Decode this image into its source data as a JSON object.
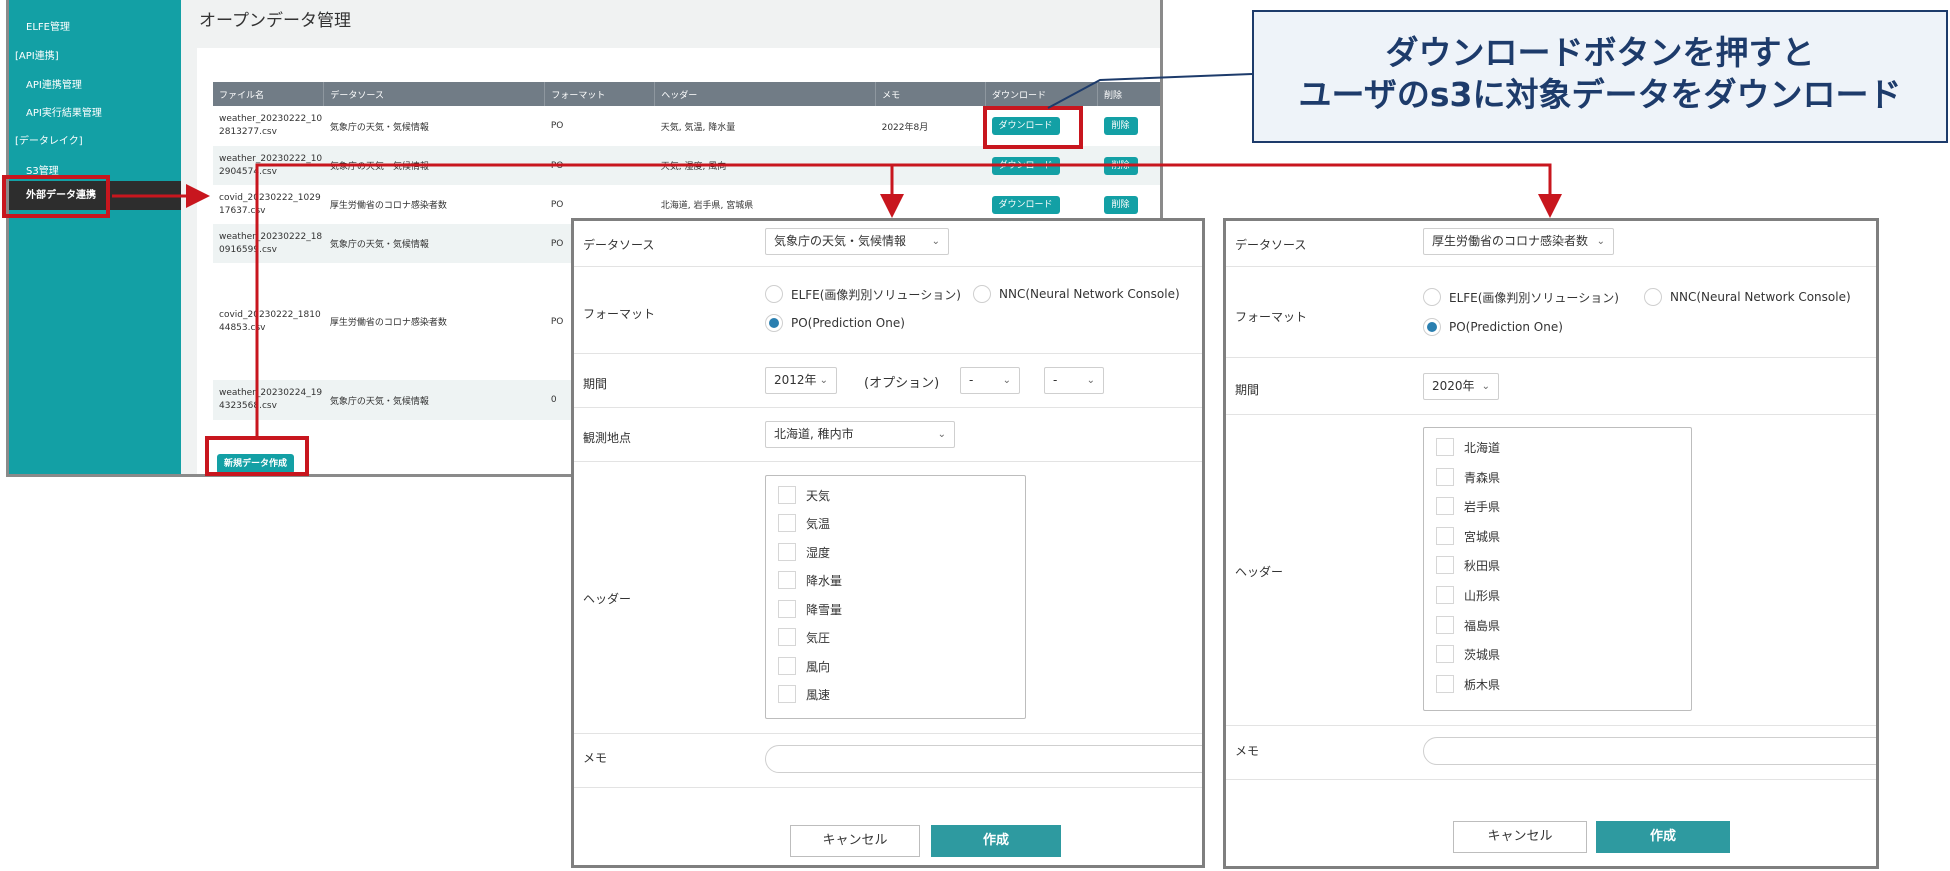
{
  "sidebar": {
    "items": [
      "ELFE管理",
      "[API連携]",
      "API連携管理",
      "API実行結果管理",
      "[データレイク]",
      "S3管理",
      "外部データ連携"
    ]
  },
  "main": {
    "title": "オープンデータ管理",
    "columns": [
      "ファイル名",
      "データソース",
      "フォーマット",
      "ヘッダー",
      "メモ",
      "ダウンロード",
      "削除"
    ],
    "rows": [
      {
        "file": "weather_20230222_102813277.csv",
        "source": "気象庁の天気・気候情報",
        "format": "PO",
        "header": "天気, 気温, 降水量",
        "memo": "2022年8月",
        "download": "ダウンロード",
        "delete": "削除"
      },
      {
        "file": "weather_20230222_102904574.csv",
        "source": "気象庁の天気・気候情報",
        "format": "PO",
        "header": "天気, 湿度, 風向",
        "memo": "",
        "download": "ダウンロード",
        "delete": "削除"
      },
      {
        "file": "covid_20230222_102917637.csv",
        "source": "厚生労働省のコロナ感染者数",
        "format": "PO",
        "header": "北海道, 岩手県, 宮城県",
        "memo": "",
        "download": "ダウンロード",
        "delete": "削除"
      },
      {
        "file": "weather_20230222_180916599.csv",
        "source": "気象庁の天気・気候情報",
        "format": "PO",
        "header": "",
        "memo": "",
        "download": "",
        "delete": ""
      },
      {
        "file": "covid_20230222_181044853.csv",
        "source": "厚生労働省のコロナ感染者数",
        "format": "PO",
        "header": "",
        "memo": "",
        "download": "",
        "delete": ""
      },
      {
        "file": "weather_20230224_194323568.csv",
        "source": "気象庁の天気・気候情報",
        "format": "0",
        "header": "",
        "memo": "",
        "download": "",
        "delete": ""
      }
    ],
    "new_button": "新規データ作成"
  },
  "callout": {
    "line1": "ダウンロードボタンを押すと",
    "line2": "ユーザのs3に対象データをダウンロード"
  },
  "dialog_weather": {
    "source_label": "データソース",
    "source_value": "気象庁の天気・気候情報",
    "format_label": "フォーマット",
    "format_options": [
      "ELFE(画像判別ソリューション)",
      "NNC(Neural Network Console)",
      "PO(Prediction One)"
    ],
    "format_selected": "PO(Prediction One)",
    "period_label": "期間",
    "period_value": "2012年",
    "option_text": "(オプション)",
    "option_sel1": "-",
    "option_sel2": "-",
    "station_label": "観測地点",
    "station_value": "北海道, 稚内市",
    "header_label": "ヘッダー",
    "header_items": [
      "天気",
      "気温",
      "湿度",
      "降水量",
      "降雪量",
      "気圧",
      "風向",
      "風速"
    ],
    "memo_label": "メモ",
    "cancel": "キャンセル",
    "create": "作成"
  },
  "dialog_covid": {
    "source_label": "データソース",
    "source_value": "厚生労働省のコロナ感染者数",
    "format_label": "フォーマット",
    "format_options": [
      "ELFE(画像判別ソリューション)",
      "NNC(Neural Network Console)",
      "PO(Prediction One)"
    ],
    "format_selected": "PO(Prediction One)",
    "period_label": "期間",
    "period_value": "2020年",
    "header_label": "ヘッダー",
    "header_items": [
      "北海道",
      "青森県",
      "岩手県",
      "宮城県",
      "秋田県",
      "山形県",
      "福島県",
      "茨城県",
      "栃木県"
    ],
    "memo_label": "メモ",
    "cancel": "キャンセル",
    "create": "作成"
  },
  "colors": {
    "teal": "#13a0a5",
    "annotation_red": "#c8161e",
    "callout_navy": "#1d3b6b"
  }
}
